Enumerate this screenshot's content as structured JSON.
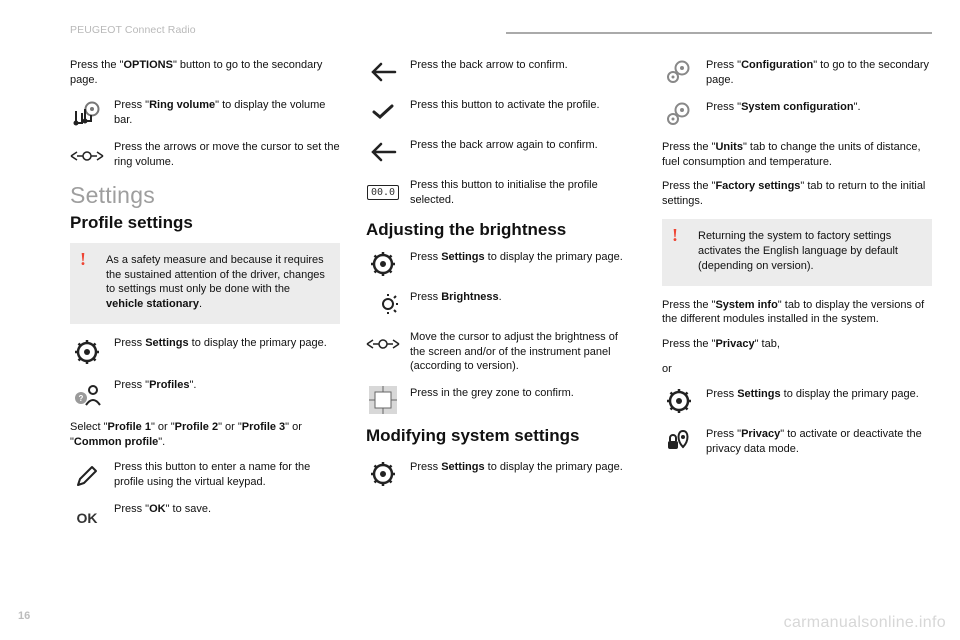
{
  "meta": {
    "breadcrumb": "PEUGEOT Connect Radio",
    "page_number": "16",
    "watermark": "carmanualsonline.info"
  },
  "col1": {
    "intro_pre": "Press the \"",
    "intro_bold": "OPTIONS",
    "intro_post": "\" button to go to the secondary page.",
    "ring_volume_pre": "Press \"",
    "ring_volume_bold": "Ring volume",
    "ring_volume_post": "\" to display the volume bar.",
    "arrows": "Press the arrows or move the cursor to set the ring volume.",
    "settings_heading": "Settings",
    "profile_heading": "Profile settings",
    "warning_pre": "As a safety measure and because it requires the sustained attention of the driver, changes to settings must only be done with the ",
    "warning_bold": "vehicle stationary",
    "warning_post": ".",
    "press_settings_pre": "Press ",
    "press_settings_bold": "Settings",
    "press_settings_post": " to display the primary page.",
    "press_profiles_pre": "Press \"",
    "press_profiles_bold": "Profiles",
    "press_profiles_post": "\".",
    "select_profile": {
      "pre": "Select \"",
      "p1": "Profile 1",
      "mid1": "\" or \"",
      "p2": "Profile 2",
      "mid2": "\" or \"",
      "p3": "Profile 3",
      "mid3": "\" or \"",
      "p4": "Common profile",
      "post": "\"."
    },
    "enter_name": "Press this button to enter a name for the profile using the virtual keypad.",
    "ok_label": "OK",
    "press_ok_pre": "Press \"",
    "press_ok_bold": "OK",
    "press_ok_post": "\" to save."
  },
  "col2": {
    "back_confirm": "Press the back arrow to confirm.",
    "activate_profile": "Press this button to activate the profile.",
    "back_again": "Press the back arrow again to confirm.",
    "init_profile": "Press this button to initialise the profile selected.",
    "init_icon_text": "00.0",
    "brightness_heading": "Adjusting the brightness",
    "press_settings_pre": "Press ",
    "press_settings_bold": "Settings",
    "press_settings_post": " to display the primary page.",
    "press_brightness_pre": "Press ",
    "press_brightness_bold": "Brightness",
    "press_brightness_post": ".",
    "move_cursor": "Move the cursor to adjust the brightness of the screen and/or of the instrument panel (according to version).",
    "grey_zone": "Press in the grey zone to confirm.",
    "modify_heading": "Modifying system settings",
    "press_settings2_pre": "Press ",
    "press_settings2_bold": "Settings",
    "press_settings2_post": " to display the primary page."
  },
  "col3": {
    "press_config_pre": "Press \"",
    "press_config_bold": "Configuration",
    "press_config_post": "\" to go to the secondary page.",
    "press_sysconfig_pre": "Press \"",
    "press_sysconfig_bold": "System configuration",
    "press_sysconfig_post": "\".",
    "units_pre": "Press the \"",
    "units_bold": "Units",
    "units_post": "\" tab to change the units of distance, fuel consumption and temperature.",
    "factory_pre": "Press the \"",
    "factory_bold": "Factory settings",
    "factory_post": "\" tab to return to the initial settings.",
    "factory_warning": "Returning the system to factory settings activates the English language by default (depending on version).",
    "sysinfo_pre": "Press the \"",
    "sysinfo_bold": "System info",
    "sysinfo_post": "\" tab to display the versions of the different modules installed in the system.",
    "privacy_tab_pre": "Press the \"",
    "privacy_tab_bold": "Privacy",
    "privacy_tab_post": "\" tab,",
    "or": "or",
    "press_settings_pre": "Press ",
    "press_settings_bold": "Settings",
    "press_settings_post": " to display the primary page.",
    "press_privacy_pre": "Press \"",
    "press_privacy_bold": "Privacy",
    "press_privacy_post": "\" to activate or deactivate the privacy data mode."
  }
}
